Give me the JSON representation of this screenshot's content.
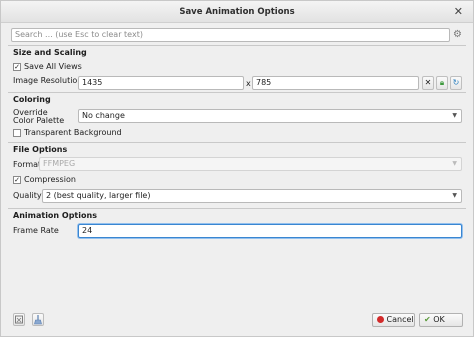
{
  "window": {
    "title": "Save Animation Options"
  },
  "search": {
    "placeholder": "Search ... (use Esc to clear text)"
  },
  "sections": {
    "size_scaling": "Size and Scaling",
    "coloring": "Coloring",
    "file_options": "File Options",
    "animation_options": "Animation Options"
  },
  "size_scaling": {
    "save_all_views_label": "Save All Views",
    "save_all_views_checked": true,
    "image_resolution_label": "Image Resolution",
    "width": "1435",
    "x_label": "x",
    "height": "785"
  },
  "coloring": {
    "override_label_line1": "Override",
    "override_label_line2": "Color Palette",
    "palette_value": "No change",
    "transparent_label": "Transparent Background",
    "transparent_checked": false
  },
  "file_options": {
    "format_label": "Format",
    "format_value": "FFMPEG",
    "compression_label": "Compression",
    "compression_checked": true,
    "quality_label": "Quality",
    "quality_value": "2 (best quality, larger file)"
  },
  "animation": {
    "frame_rate_label": "Frame Rate",
    "frame_rate_value": "24"
  },
  "footer": {
    "cancel_label": "Cancel",
    "ok_label": "OK"
  },
  "colors": {
    "cancel_icon": "#d22a2a",
    "ok_icon": "#5a9a3a",
    "lock_icon": "#3e9a3e",
    "refresh_icon": "#2a7fbf",
    "focus_border": "#3a86d1"
  }
}
